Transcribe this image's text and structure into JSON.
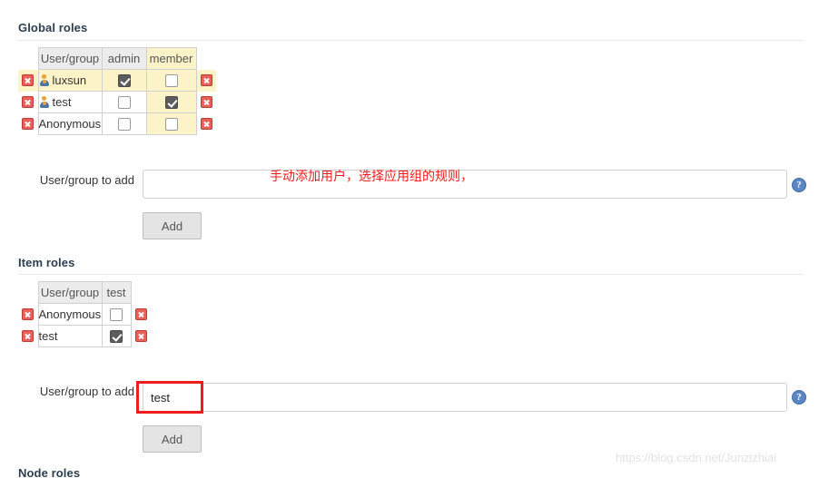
{
  "sections": {
    "global_roles": {
      "heading": "Global roles",
      "table": {
        "columns": [
          "User/group",
          "admin",
          "member"
        ],
        "rows": [
          {
            "name": "luxsun",
            "has_user_icon": true,
            "highlight": true,
            "checks": [
              true,
              false
            ]
          },
          {
            "name": "test",
            "has_user_icon": true,
            "highlight": false,
            "checks": [
              false,
              true
            ]
          },
          {
            "name": "Anonymous",
            "has_user_icon": false,
            "highlight": false,
            "checks": [
              false,
              false
            ]
          }
        ]
      },
      "add_row": {
        "label": "User/group to add",
        "input_value": "",
        "input_placeholder": "",
        "button_label": "Add",
        "help_icon": "help-question-icon"
      }
    },
    "item_roles": {
      "heading": "Item roles",
      "table": {
        "columns": [
          "User/group",
          "test"
        ],
        "rows": [
          {
            "name": "Anonymous",
            "has_user_icon": false,
            "highlight": false,
            "checks": [
              false
            ]
          },
          {
            "name": "test",
            "has_user_icon": false,
            "highlight": false,
            "checks": [
              true
            ]
          }
        ]
      },
      "add_row": {
        "label": "User/group to add",
        "input_value": "test",
        "input_placeholder": "",
        "button_label": "Add",
        "help_icon": "help-question-icon"
      }
    },
    "node_roles": {
      "heading": "Node roles"
    }
  },
  "annotations": {
    "global_add_note": "手动添加用户，选择应用组的规则，",
    "note_color": "#ee1c1c",
    "box_color": "#ee1c1c"
  },
  "watermark": {
    "text": "https://blog.csdn.net/Junzizhiai"
  },
  "icons": {
    "delete": "delete-x-icon",
    "user": "user-person-icon",
    "help": "help-question-icon"
  }
}
